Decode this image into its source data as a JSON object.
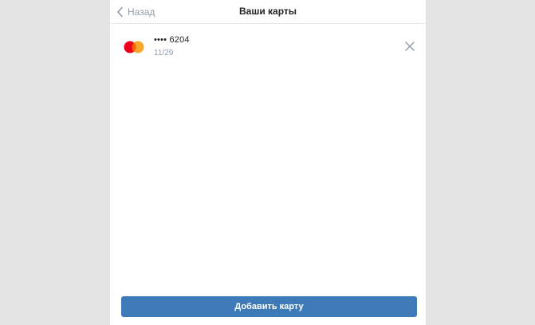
{
  "header": {
    "back_label": "Назад",
    "title": "Ваши карты"
  },
  "cards": [
    {
      "masked_number": "•••• 6204",
      "expiry": "11/29",
      "brand_icon": "mastercard-logo-icon",
      "remove_icon": "close-icon"
    }
  ],
  "footer": {
    "add_card_label": "Добавить карту"
  },
  "colors": {
    "background": "#e4e4e4",
    "panel": "#ffffff",
    "accent": "#3f7ab8",
    "muted_text": "#8e9cad",
    "mastercard_red": "#eb001b",
    "mastercard_orange": "#f79e1b"
  }
}
